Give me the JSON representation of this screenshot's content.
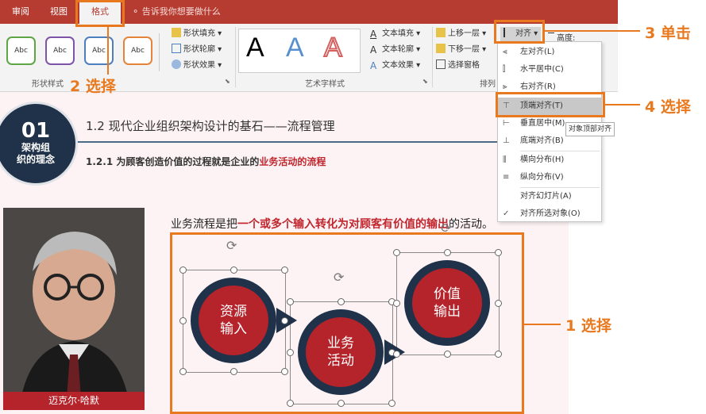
{
  "tabs": {
    "review": "审阅",
    "view": "视图",
    "format": "格式"
  },
  "tellme": "告诉我你想要做什么",
  "ribbon": {
    "style_label": "Abc",
    "shape_fill": "形状填充",
    "shape_outline": "形状轮廓",
    "shape_effect": "形状效果",
    "shape_styles_group": "形状样式",
    "wordart_letter": "A",
    "text_fill": "文本填充",
    "text_outline": "文本轮廓",
    "text_effect": "文本效果",
    "wordart_group": "艺术字样式",
    "bring_forward": "上移一层",
    "send_backward": "下移一层",
    "selection_pane": "选择窗格",
    "arrange_group": "排列",
    "align": "对齐",
    "height": "高度:"
  },
  "menu": {
    "items": [
      "左对齐(L)",
      "水平居中(C)",
      "右对齐(R)",
      "顶端对齐(T)",
      "垂直居中(M)",
      "底端对齐(B)",
      "横向分布(H)",
      "纵向分布(V)",
      "对齐幻灯片(A)",
      "对齐所选对象(O)"
    ],
    "tooltip": "对象顶部对齐"
  },
  "slide": {
    "badge_number": "01",
    "badge_text": "架构组\n织的理念",
    "title": "1.2 现代企业组织架构设计的基石——流程管理",
    "subtitle_prefix": "1.2.1 为顾客创造价值的过程就是企业的",
    "subtitle_highlight": "业务活动的流程",
    "body_prefix": "业务流程是把",
    "body_highlight": "一个或多个输入转化为对顾客有价值的输出",
    "body_suffix": "的活动。",
    "photo_caption": "迈克尔·哈默",
    "shape1": "资源\n输入",
    "shape2": "业务\n活动",
    "shape3": "价值\n输出"
  },
  "callouts": {
    "c1": "1 选择",
    "c2": "2 选择",
    "c3": "3 单击",
    "c4": "4 选择"
  },
  "colors": {
    "accent": "#b63b30",
    "callout": "#e8791f",
    "navy": "#1f3249",
    "red": "#b5232b"
  }
}
